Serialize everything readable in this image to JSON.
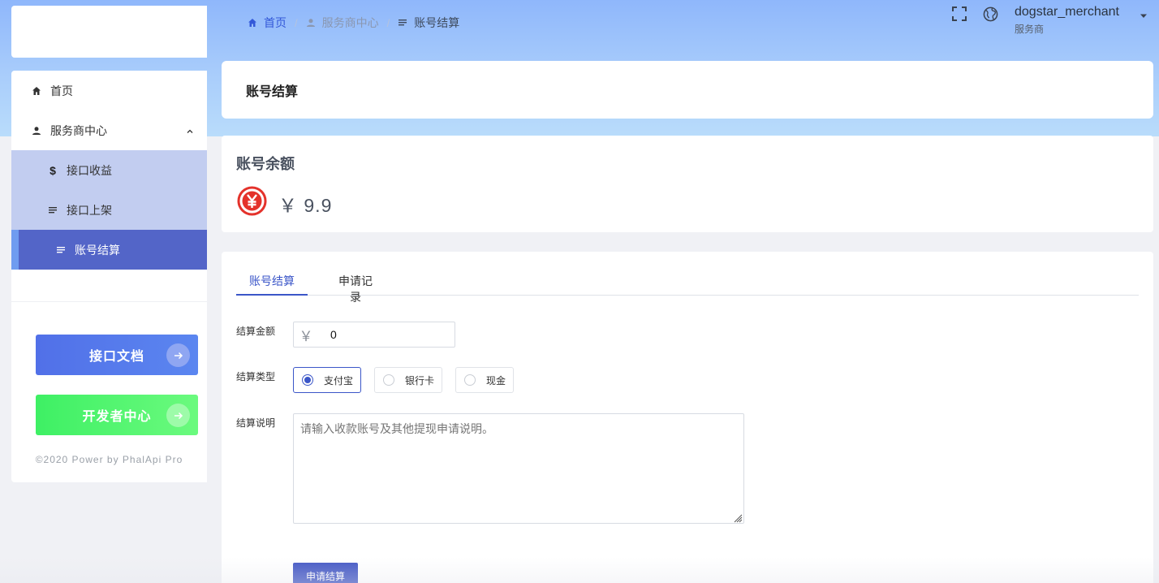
{
  "sidebar": {
    "menu": [
      {
        "label": "首页",
        "icon": "home-icon"
      },
      {
        "label": "服务商中心",
        "icon": "user-icon"
      },
      {
        "label": "接口收益",
        "icon": "dollar-icon"
      },
      {
        "label": "接口上架",
        "icon": "list-icon"
      },
      {
        "label": "账号结算",
        "icon": "list-icon",
        "active": true
      }
    ],
    "docs_button": "接口文档",
    "dev_button": "开发者中心",
    "copyright": "©2020 Power by PhalApi Pro"
  },
  "breadcrumb": {
    "home": "首页",
    "service": "服务商中心",
    "current": "账号结算"
  },
  "user": {
    "name": "dogstar_merchant",
    "role": "服务商"
  },
  "page": {
    "title": "账号结算"
  },
  "balance": {
    "title": "账号余额",
    "value": "￥ 9.9"
  },
  "tabs": {
    "settle": "账号结算",
    "records": "申请记录"
  },
  "form": {
    "amount_label": "结算金额",
    "amount_prefix": "￥",
    "amount_value": "0",
    "type_label": "结算类型",
    "type_options": [
      "支付宝",
      "银行卡",
      "现金"
    ],
    "selected_type": "支付宝",
    "desc_label": "结算说明",
    "desc_placeholder": "请输入收款账号及其他提现申请说明。",
    "submit": "申请结算"
  },
  "colors": {
    "primary": "#3b56c8",
    "active_menu": "#5365c8",
    "sub_menu": "#c2cdf0",
    "dev_button": "#4ef36e",
    "yuan_red": "#e4322b"
  }
}
